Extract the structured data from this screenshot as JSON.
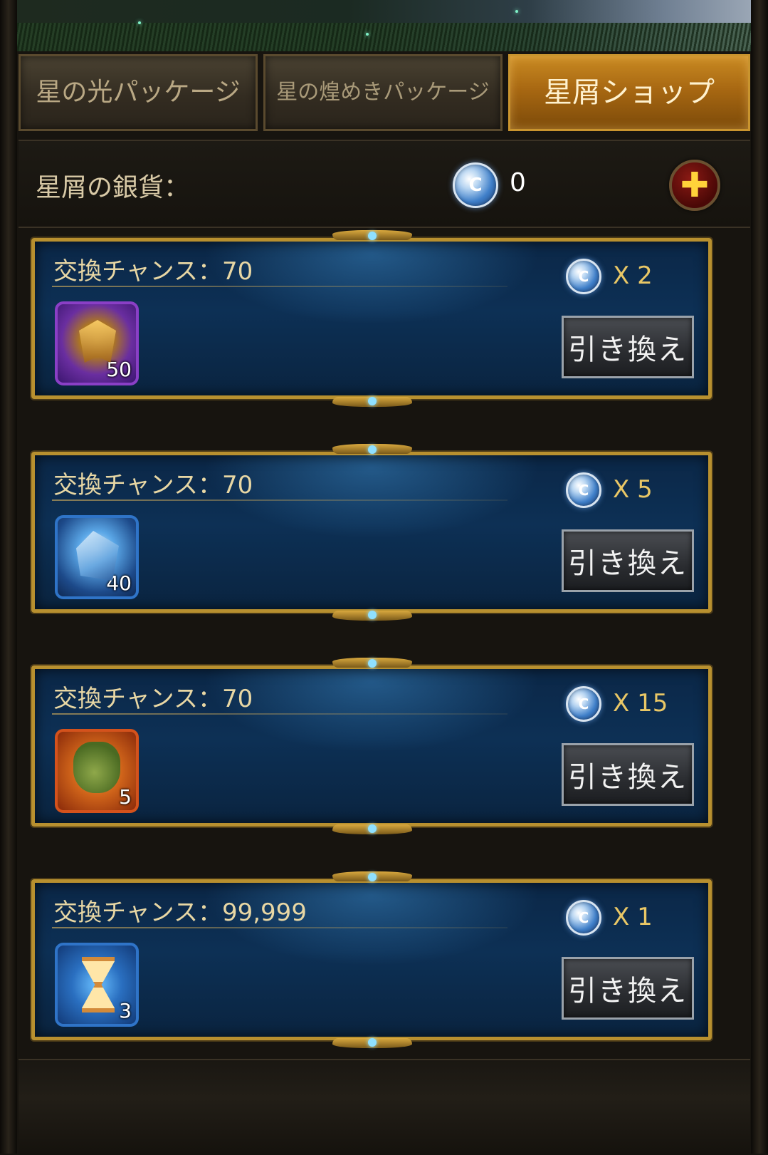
{
  "tabs": [
    {
      "label": "星の光パッケージ",
      "active": false
    },
    {
      "label": "星の煌めきパッケージ",
      "active": false
    },
    {
      "label": "星屑ショップ",
      "active": true
    }
  ],
  "currency": {
    "label": "星屑の銀貨：",
    "icon": "silver-coin-icon",
    "coin_glyph": "C",
    "value": "0",
    "add_icon": "plus-icon",
    "add_glyph": "✚"
  },
  "offers": [
    {
      "chance": "交換チャンス：70",
      "cost": "X 2",
      "item_icon": "badge-medal-icon",
      "item_count": "50",
      "button": "引き換え"
    },
    {
      "chance": "交換チャンス：70",
      "cost": "X 5",
      "item_icon": "crystal-ore-icon",
      "item_count": "40",
      "button": "引き換え"
    },
    {
      "chance": "交換チャンス：70",
      "cost": "X 15",
      "item_icon": "gem-bag-icon",
      "item_count": "5",
      "button": "引き換え"
    },
    {
      "chance": "交換チャンス：99,999",
      "cost": "X 1",
      "item_icon": "hourglass-icon",
      "item_count": "3",
      "button": "引き換え"
    }
  ],
  "colors": {
    "active_tab": "#c98a22",
    "card_border": "#b8902f",
    "card_bg": "#0d3055",
    "cost_text": "#e9c766",
    "chance_text": "#e8d7a4"
  }
}
